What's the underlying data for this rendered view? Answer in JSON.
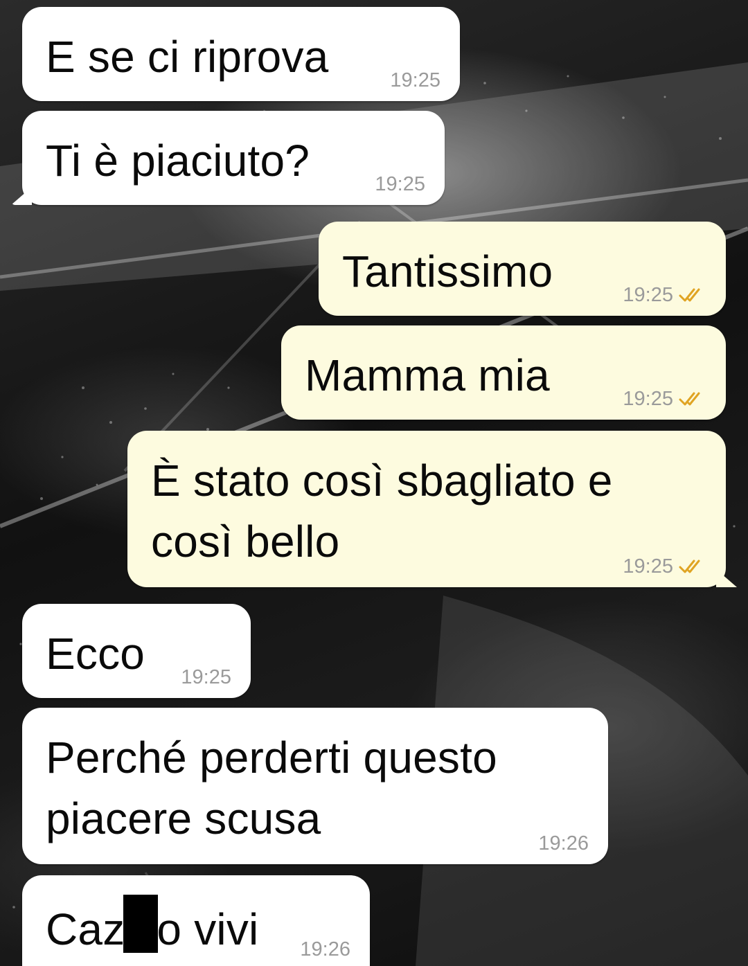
{
  "colors": {
    "incoming_bubble": "#ffffff",
    "outgoing_bubble": "#fdfbdf",
    "timestamp": "#9a9a9a",
    "read_checks": "#e0a423"
  },
  "messages": [
    {
      "id": "m1",
      "direction": "incoming",
      "text": "E se ci riprova",
      "time": "19:25"
    },
    {
      "id": "m2",
      "direction": "incoming",
      "text": "Ti è piaciuto?",
      "time": "19:25"
    },
    {
      "id": "m3",
      "direction": "outgoing",
      "text": "Tantissimo",
      "time": "19:25",
      "status": "read"
    },
    {
      "id": "m4",
      "direction": "outgoing",
      "text": "Mamma mia",
      "time": "19:25",
      "status": "read"
    },
    {
      "id": "m5",
      "direction": "outgoing",
      "text": "È stato così sbagliato e\ncosì bello",
      "time": "19:25",
      "status": "read"
    },
    {
      "id": "m6",
      "direction": "incoming",
      "text": "Ecco",
      "time": "19:25"
    },
    {
      "id": "m7",
      "direction": "incoming",
      "text": "Perché perderti questo\npiacere scusa",
      "time": "19:26"
    },
    {
      "id": "m8",
      "direction": "incoming",
      "text_before_redaction": "Caz",
      "text_after_redaction": "o vivi",
      "time": "19:26"
    }
  ]
}
